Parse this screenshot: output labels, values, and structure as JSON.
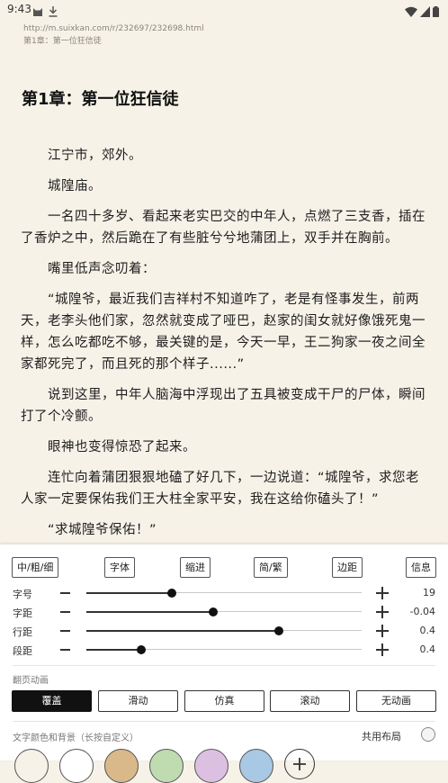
{
  "status_bar": {
    "time": "9:43"
  },
  "reader": {
    "url": "http://m.suixkan.com/r/232697/232698.html",
    "chapter_small": "第1章：第一位狂信徒",
    "chapter_title": "第1章：第一位狂信徒",
    "paragraphs": [
      "江宁市，郊外。",
      "城隍庙。",
      "一名四十多岁、看起来老实巴交的中年人，点燃了三支香，插在了香炉之中，然后跪在了有些脏兮兮地蒲团上，双手并在胸前。",
      "嘴里低声念叨着：",
      "“城隍爷，最近我们吉祥村不知道咋了，老是有怪事发生，前两天，老李头他们家，忽然就变成了哑巴，赵家的闺女就好像饿死鬼一样，怎么吃都吃不够，最关键的是，今天一早，王二狗家一夜之间全家都死完了，而且死的那个样子......”",
      "说到这里，中年人脑海中浮现出了五具被变成干尸的尸体，瞬间打了个冷颤。",
      "眼神也变得惊恐了起来。",
      "连忙向着蒲团狠狠地磕了好几下，一边说道：“城隍爷，求您老人家一定要保佑我们王大柱全家平安，我在这给你磕头了！”",
      "“求城隍爷保佑！”"
    ]
  },
  "panel": {
    "options": [
      "中/粗/细",
      "字体",
      "缩进",
      "简/繁",
      "边距",
      "信息"
    ],
    "sliders": [
      {
        "label": "字号",
        "value_text": "19",
        "fraction": 0.31
      },
      {
        "label": "字距",
        "value_text": "-0.04",
        "fraction": 0.46
      },
      {
        "label": "行距",
        "value_text": "0.4",
        "fraction": 0.7
      },
      {
        "label": "段距",
        "value_text": "0.4",
        "fraction": 0.2
      }
    ],
    "page_anim_label": "翻页动画",
    "anim_options": [
      "覆盖",
      "滑动",
      "仿真",
      "滚动",
      "无动画"
    ],
    "anim_selected": "覆盖",
    "color_label": "文字颜色和背景（长按自定义）",
    "shared_layout_label": "共用布局",
    "swatches": [
      "#f7f2e8",
      "#ffffff",
      "#d9b98a",
      "#bfdcb0",
      "#dcc0e2",
      "#a8c8e4"
    ],
    "icons": [
      "cat-icon",
      "download-icon",
      "wifi-icon",
      "signal-icon",
      "battery-icon",
      "add-icon"
    ]
  }
}
